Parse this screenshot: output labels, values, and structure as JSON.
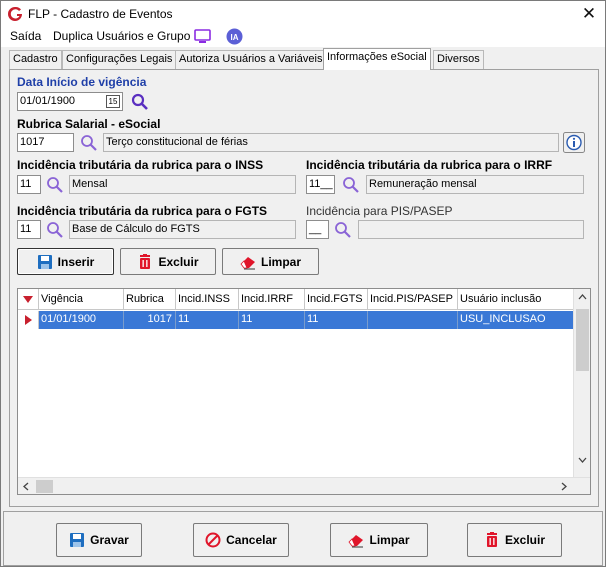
{
  "window": {
    "title": "FLP - Cadastro de Eventos",
    "close_icon": "close-icon"
  },
  "menu": {
    "items": [
      "Saída",
      "Duplica Usuários e Grupo"
    ]
  },
  "tabs": [
    "Cadastro",
    "Configurações Legais",
    "Autoriza Usuários a Variáveis",
    "Informações eSocial",
    "Diversos"
  ],
  "active_tab": "Informações eSocial",
  "form": {
    "data_inicio_label": "Data Início de vigência",
    "data_inicio_value": "01/01/1900",
    "rubrica_label": "Rubrica Salarial - eSocial",
    "rubrica_code": "1017",
    "rubrica_desc": "Terço constitucional de férias",
    "inss_label": "Incidência tributária da rubrica para o INSS",
    "inss_code": "11",
    "inss_desc": "Mensal",
    "irrf_label": "Incidência tributária da rubrica para o IRRF",
    "irrf_code": "11__",
    "irrf_desc": "Remuneração mensal",
    "fgts_label": "Incidência tributária da rubrica para o FGTS",
    "fgts_code": "11",
    "fgts_desc": "Base de Cálculo do FGTS",
    "pis_label": "Incidência para PIS/PASEP",
    "pis_code": "__",
    "pis_desc": ""
  },
  "actions": {
    "insert": "Inserir",
    "delete": "Excluir",
    "clear": "Limpar"
  },
  "grid": {
    "columns": [
      "Vigência",
      "Rubrica",
      "Incid.INSS",
      "Incid.IRRF",
      "Incid.FGTS",
      "Incid.PIS/PASEP",
      "Usuário inclusão"
    ],
    "rows": [
      {
        "vigencia": "01/01/1900",
        "rubrica": "1017",
        "inss": "11",
        "irrf": "11",
        "fgts": "11",
        "pis": "",
        "usuario": "USU_INCLUSAO"
      }
    ]
  },
  "footer": {
    "save": "Gravar",
    "cancel": "Cancelar",
    "clear": "Limpar",
    "delete": "Excluir"
  },
  "colors": {
    "accent_blue": "#1f3fa8",
    "selection": "#3a78d6",
    "brand_red": "#c8202e",
    "search_purple": "#6a3fd0"
  }
}
